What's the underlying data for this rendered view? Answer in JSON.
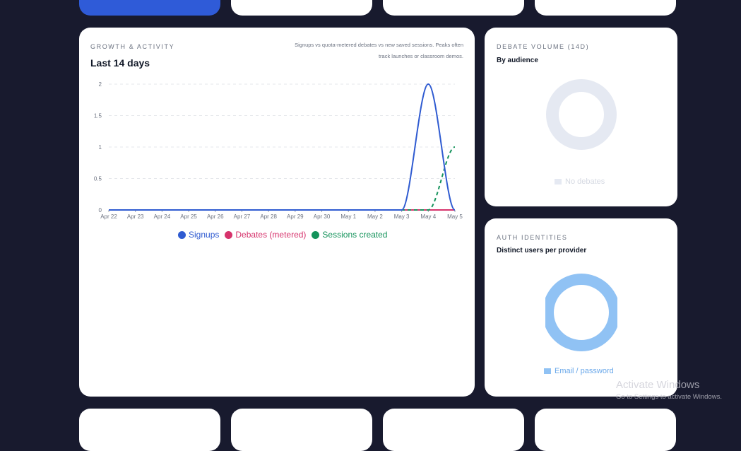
{
  "growth": {
    "eyebrow": "GROWTH & ACTIVITY",
    "title": "Last 14 days",
    "note_line1": "Signups vs quota-metered debates vs new saved sessions. Peaks often",
    "note_line2": "track launches or classroom demos."
  },
  "chart_data": {
    "type": "line",
    "x": [
      "Apr 22",
      "Apr 23",
      "Apr 24",
      "Apr 25",
      "Apr 26",
      "Apr 27",
      "Apr 28",
      "Apr 29",
      "Apr 30",
      "May 1",
      "May 2",
      "May 3",
      "May 4",
      "May 5"
    ],
    "ylim": [
      0,
      2
    ],
    "yticks": [
      "0",
      "0.5",
      "1",
      "1.5",
      "2"
    ],
    "grid": true,
    "legend_position": "bottom",
    "series": [
      {
        "name": "Signups",
        "color": "#2f5bd1",
        "values": [
          0,
          0,
          0,
          0,
          0,
          0,
          0,
          0,
          0,
          0,
          0,
          0,
          2,
          0
        ]
      },
      {
        "name": "Debates (metered)",
        "color": "#d6336c",
        "values": [
          0,
          0,
          0,
          0,
          0,
          0,
          0,
          0,
          0,
          0,
          0,
          0,
          0,
          0
        ]
      },
      {
        "name": "Sessions created",
        "color": "#14935b",
        "dashed": true,
        "values": [
          0,
          0,
          0,
          0,
          0,
          0,
          0,
          0,
          0,
          0,
          0,
          0,
          0,
          1
        ]
      }
    ]
  },
  "debate_volume": {
    "eyebrow": "DEBATE VOLUME (14D)",
    "title": "By audience",
    "legend": "No debates",
    "ring_color": "#e5e9f2"
  },
  "auth": {
    "eyebrow": "AUTH IDENTITIES",
    "title": "Distinct users per provider",
    "legend": "Email / password",
    "ring_color": "#90c2f4"
  },
  "watermark": {
    "line1": "Activate Windows",
    "line2": "Go to Settings to activate Windows."
  }
}
